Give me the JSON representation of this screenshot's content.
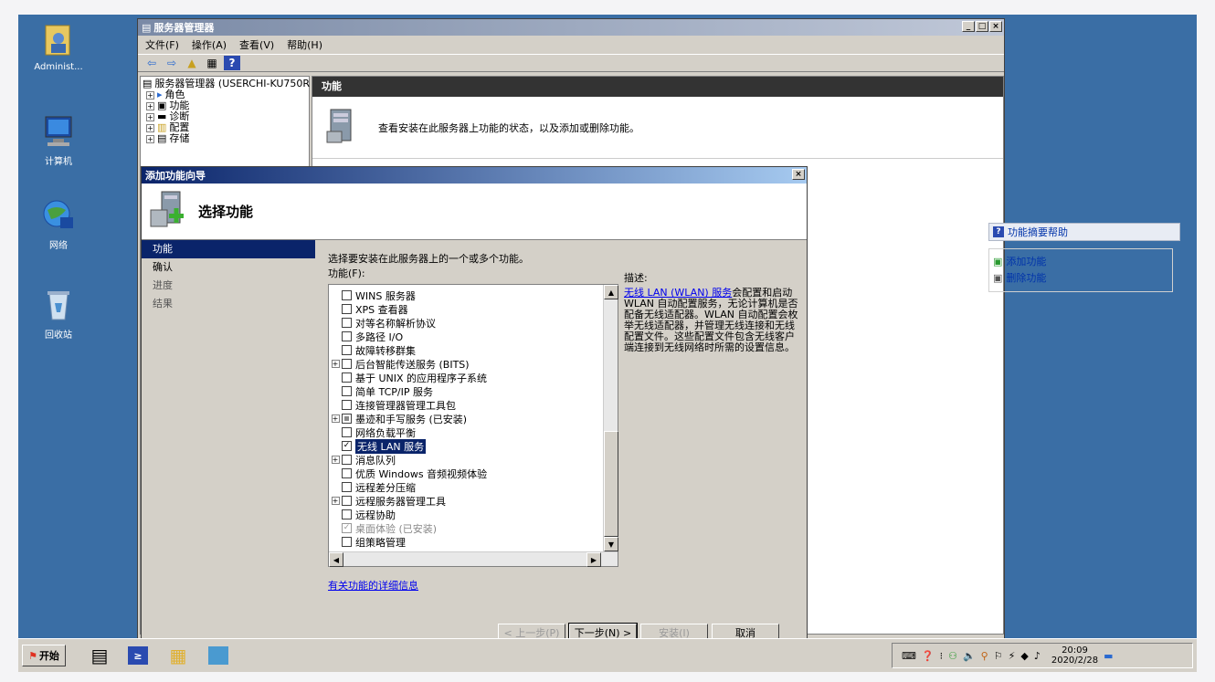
{
  "desktop": {
    "icons": [
      {
        "label": "Administ...",
        "icon": "user-folder-icon"
      },
      {
        "label": "计算机",
        "icon": "computer-icon"
      },
      {
        "label": "网络",
        "icon": "network-icon"
      },
      {
        "label": "回收站",
        "icon": "recycle-bin-icon"
      }
    ]
  },
  "window": {
    "title": "服务器管理器",
    "menu": [
      "文件(F)",
      "操作(A)",
      "查看(V)",
      "帮助(H)"
    ],
    "tree": [
      {
        "label": "服务器管理器 (USERCHI-KU750R",
        "expander": ""
      },
      {
        "label": "角色",
        "expander": "+"
      },
      {
        "label": "功能",
        "expander": "+"
      },
      {
        "label": "诊断",
        "expander": "+"
      },
      {
        "label": "配置",
        "expander": "+"
      },
      {
        "label": "存储",
        "expander": "+"
      }
    ],
    "pane_header": "功能",
    "pane_desc": "查看安装在此服务器上功能的状态，以及添加或删除功能。",
    "help": {
      "title": "功能摘要帮助",
      "links": [
        "添加功能",
        "删除功能"
      ]
    }
  },
  "wizard": {
    "title": "添加功能向导",
    "heading": "选择功能",
    "nav": [
      {
        "label": "功能",
        "state": "active"
      },
      {
        "label": "确认",
        "state": "normal"
      },
      {
        "label": "进度",
        "state": "dim"
      },
      {
        "label": "结果",
        "state": "dim"
      }
    ],
    "instruction": "选择要安装在此服务器上的一个或多个功能。",
    "list_label": "功能(F):",
    "features": [
      {
        "label": "WINS 服务器",
        "expander": false,
        "state": "unchecked"
      },
      {
        "label": "XPS 查看器",
        "expander": false,
        "state": "unchecked"
      },
      {
        "label": "对等名称解析协议",
        "expander": false,
        "state": "unchecked"
      },
      {
        "label": "多路径 I/O",
        "expander": false,
        "state": "unchecked"
      },
      {
        "label": "故障转移群集",
        "expander": false,
        "state": "unchecked"
      },
      {
        "label": "后台智能传送服务 (BITS)",
        "expander": true,
        "state": "unchecked"
      },
      {
        "label": "基于 UNIX 的应用程序子系统",
        "expander": false,
        "state": "unchecked"
      },
      {
        "label": "简单 TCP/IP 服务",
        "expander": false,
        "state": "unchecked"
      },
      {
        "label": "连接管理器管理工具包",
        "expander": false,
        "state": "unchecked"
      },
      {
        "label": "墨迹和手写服务  (已安装)",
        "expander": true,
        "state": "partial"
      },
      {
        "label": "网络负载平衡",
        "expander": false,
        "state": "unchecked"
      },
      {
        "label": "无线 LAN 服务",
        "expander": false,
        "state": "checked",
        "selected": true
      },
      {
        "label": "消息队列",
        "expander": true,
        "state": "unchecked"
      },
      {
        "label": "优质 Windows 音频视频体验",
        "expander": false,
        "state": "unchecked"
      },
      {
        "label": "远程差分压缩",
        "expander": false,
        "state": "unchecked"
      },
      {
        "label": "远程服务器管理工具",
        "expander": true,
        "state": "unchecked"
      },
      {
        "label": "远程协助",
        "expander": false,
        "state": "unchecked"
      },
      {
        "label": "桌面体验  (已安装)",
        "expander": false,
        "state": "disabled-checked"
      },
      {
        "label": "组策略管理",
        "expander": false,
        "state": "unchecked"
      }
    ],
    "description_label": "描述:",
    "description_link": "无线 LAN (WLAN) 服务",
    "description_text": "会配置和启动 WLAN 自动配置服务，无论计算机是否配备无线适配器。WLAN 自动配置会枚举无线适配器，并管理无线连接和无线配置文件。这些配置文件包含无线客户端连接到无线网络时所需的设置信息。",
    "more_info_link": "有关功能的详细信息",
    "buttons": {
      "prev": "< 上一步(P)",
      "next": "下一步(N) >",
      "install": "安装(I)",
      "cancel": "取消"
    }
  },
  "taskbar": {
    "start": "开始",
    "time": "20:09",
    "date": "2020/2/28"
  }
}
